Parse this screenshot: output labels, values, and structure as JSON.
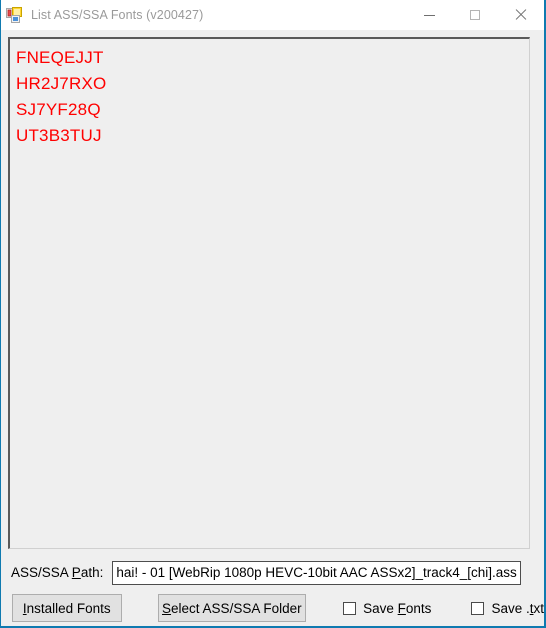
{
  "window": {
    "title": "List ASS/SSA Fonts (v200427)",
    "icon": "app-icon",
    "controls": {
      "minimize": "minimize-button",
      "maximize": "maximize-button",
      "close": "close-button"
    },
    "border_color": "#0f7ab0",
    "titlebar_bg": "#ffffff",
    "titlebar_text_color": "#9a9a9a"
  },
  "font_list": {
    "text_color": "#ff0000",
    "background": "#efefef",
    "items": [
      {
        "name": "FNEQEJJT"
      },
      {
        "name": "HR2J7RXO"
      },
      {
        "name": "SJ7YF28Q"
      },
      {
        "name": "UT3B3TUJ"
      }
    ]
  },
  "path_row": {
    "label_pre": "ASS/SSA ",
    "label_accel": "P",
    "label_post": "ath:",
    "label_full": "ASS/SSA Path:",
    "input_value": "hai! - 01 [WebRip 1080p HEVC-10bit AAC ASSx2]_track4_[chi].ass",
    "input_placeholder": ""
  },
  "controls": {
    "installed_fonts": {
      "accel": "I",
      "rest": "nstalled Fonts",
      "full": "Installed Fonts"
    },
    "select_folder": {
      "accel": "S",
      "rest": "elect ASS/SSA Folder",
      "full": "Select ASS/SSA Folder"
    },
    "save_fonts": {
      "pre": "Save ",
      "accel": "F",
      "post": "onts",
      "full": "Save Fonts",
      "checked": false
    },
    "save_txt": {
      "pre": "Save .",
      "accel": "t",
      "post": "xt",
      "full": "Save .txt",
      "checked": false
    }
  }
}
